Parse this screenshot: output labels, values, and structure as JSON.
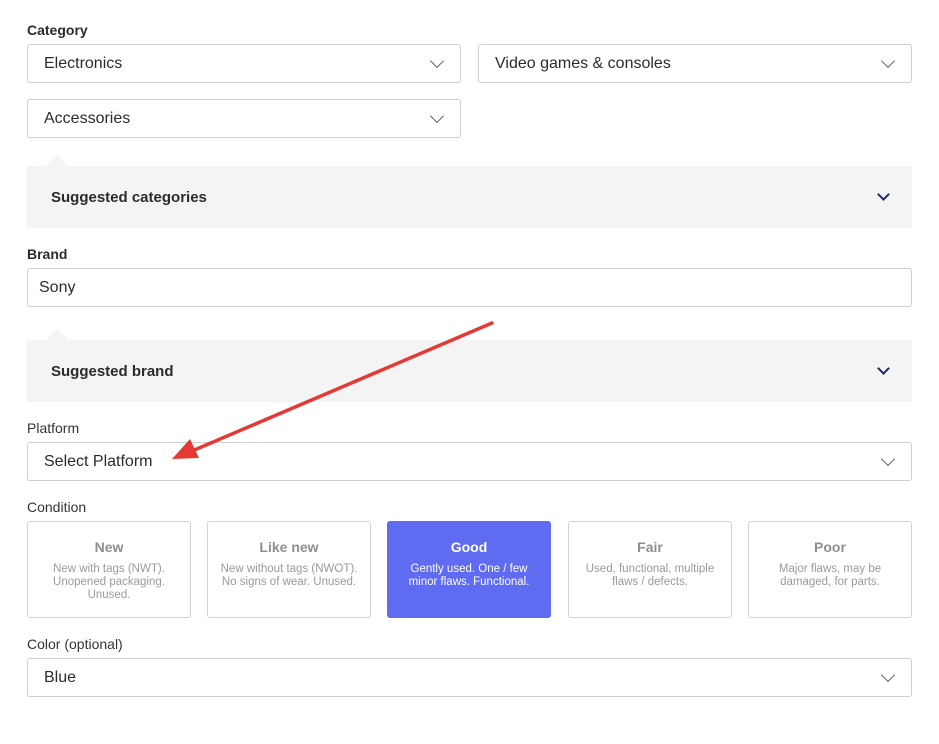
{
  "category": {
    "label": "Category",
    "level1": "Electronics",
    "level2": "Video games & consoles",
    "level3": "Accessories",
    "suggested_label": "Suggested categories"
  },
  "brand": {
    "label": "Brand",
    "value": "Sony",
    "suggested_label": "Suggested brand"
  },
  "platform": {
    "label": "Platform",
    "placeholder": "Select Platform"
  },
  "condition": {
    "label": "Condition",
    "options": [
      {
        "title": "New",
        "desc": "New with tags (NWT). Unopened packaging. Unused."
      },
      {
        "title": "Like new",
        "desc": "New without tags (NWOT). No signs of wear. Unused."
      },
      {
        "title": "Good",
        "desc": "Gently used. One / few minor flaws. Functional."
      },
      {
        "title": "Fair",
        "desc": "Used, functional, multiple flaws / defects."
      },
      {
        "title": "Poor",
        "desc": "Major flaws, may be damaged, for parts."
      }
    ],
    "selected": "Good"
  },
  "color": {
    "label": "Color (optional)",
    "value": "Blue"
  },
  "colors": {
    "accent": "#5f6bf0",
    "annotation_arrow": "#e53935",
    "suggest_bg": "#f4f4f4"
  }
}
